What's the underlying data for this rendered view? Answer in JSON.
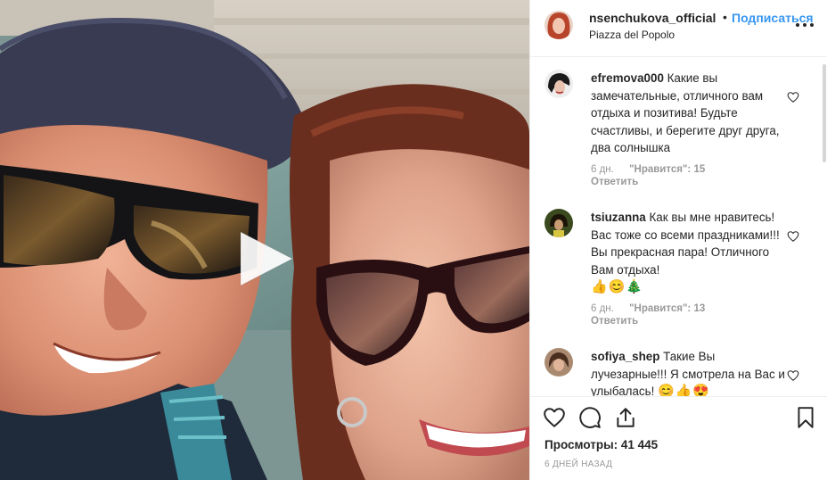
{
  "post": {
    "username": "nsenchukova_official",
    "separator": "•",
    "follow_label": "Подписаться",
    "location": "Piazza del Popolo"
  },
  "comments": [
    {
      "username": "efremova000",
      "text": "Какие вы замечательные, отличного вам отдыха и позитива! Будьте счастливы, и берегите друг друга, два солнышка",
      "emoji": "",
      "time": "6 дн.",
      "likes": "\"Нравится\": 15",
      "reply_label": "Ответить"
    },
    {
      "username": "tsiuzanna",
      "text": "Как вы мне нравитесь! Вас тоже со всеми праздниками!!! Вы прекрасная пара! Отличного Вам отдыха!",
      "emoji": "👍😊🎄",
      "time": "6 дн.",
      "likes": "\"Нравится\": 13",
      "reply_label": "Ответить"
    },
    {
      "username": "sofiya_shep",
      "text": "Такие Вы лучезарные!!! Я смотрела на Вас и улыбалась!",
      "emoji": "😊👍😍",
      "time": "",
      "likes": "",
      "reply_label": ""
    }
  ],
  "actions": {
    "icons": [
      "heart-icon",
      "comment-icon",
      "share-icon",
      "bookmark-icon"
    ],
    "views": "Просмотры: 41 445",
    "date": "6 ДНЕЙ НАЗАД"
  },
  "colors": {
    "link_blue": "#3897f0",
    "text": "#262626",
    "muted": "#999999",
    "divider": "#efefef"
  }
}
